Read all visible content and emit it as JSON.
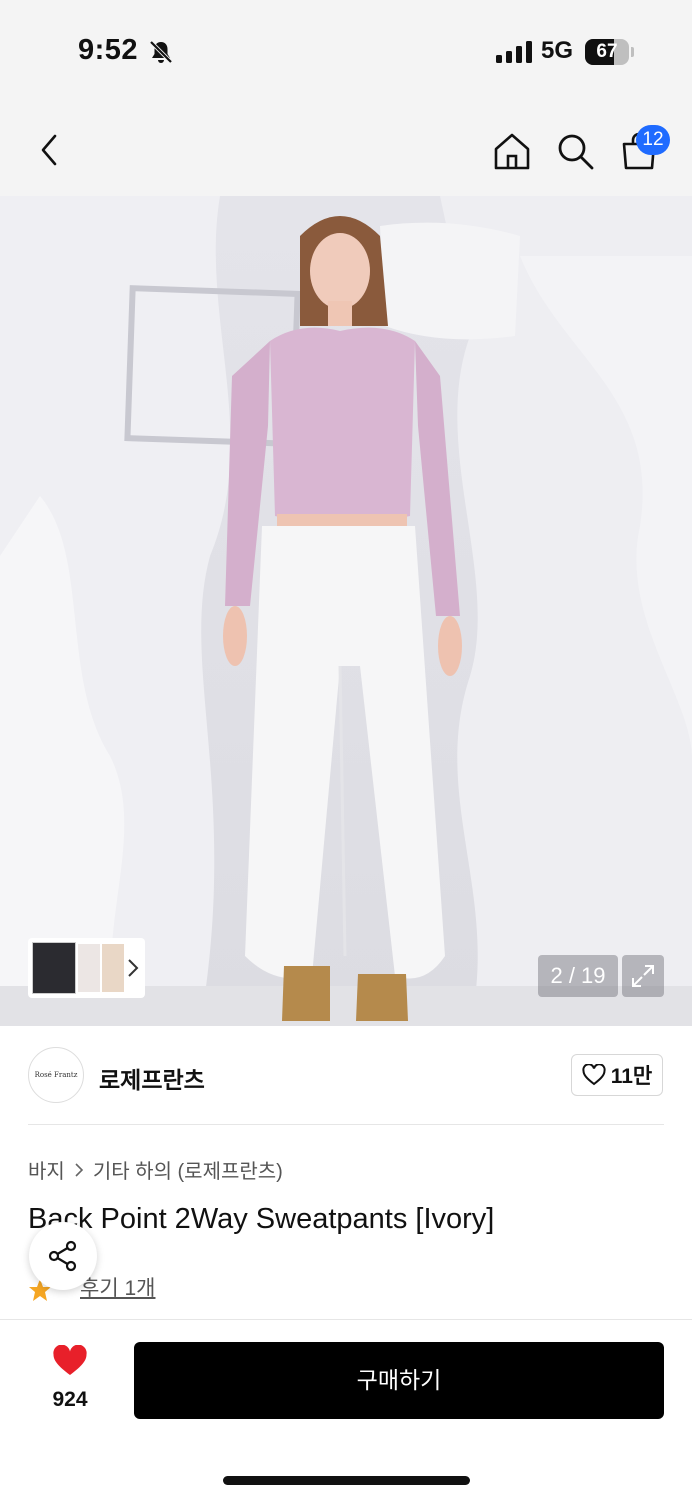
{
  "status_bar": {
    "time": "9:52",
    "network": "5G",
    "battery_percent": "67",
    "battery_level": 0.67,
    "icons": [
      "bell-slash-icon",
      "signal-icon",
      "battery-icon"
    ]
  },
  "nav": {
    "icons": [
      "chevron-left-icon",
      "home-icon",
      "search-icon",
      "shopping-bag-icon"
    ],
    "cart_count": "12",
    "cart_badge_color": "#1f6bff"
  },
  "gallery": {
    "counter": "2 / 19",
    "icons": [
      "chevron-right-icon",
      "expand-icon"
    ]
  },
  "brand": {
    "logo_text": "Rosé Frantz",
    "name": "로제프란츠",
    "like_count": "11만",
    "like_icon": "heart-outline-icon"
  },
  "breadcrumb": {
    "category": "바지",
    "separator_icon": "chevron-right-icon",
    "subcategory": "기타 하의 (로제프란츠)"
  },
  "product": {
    "title": "Back Point 2Way Sweatpants [Ivory]",
    "rating_icon": "star-icon",
    "rating_color": "#f5a623",
    "reviews": "후기 1개"
  },
  "share": {
    "icon": "share-icon"
  },
  "bottom": {
    "wish_count": "924",
    "wish_icon": "heart-filled-icon",
    "wish_color": "#e8202a",
    "buy_label": "구매하기"
  }
}
